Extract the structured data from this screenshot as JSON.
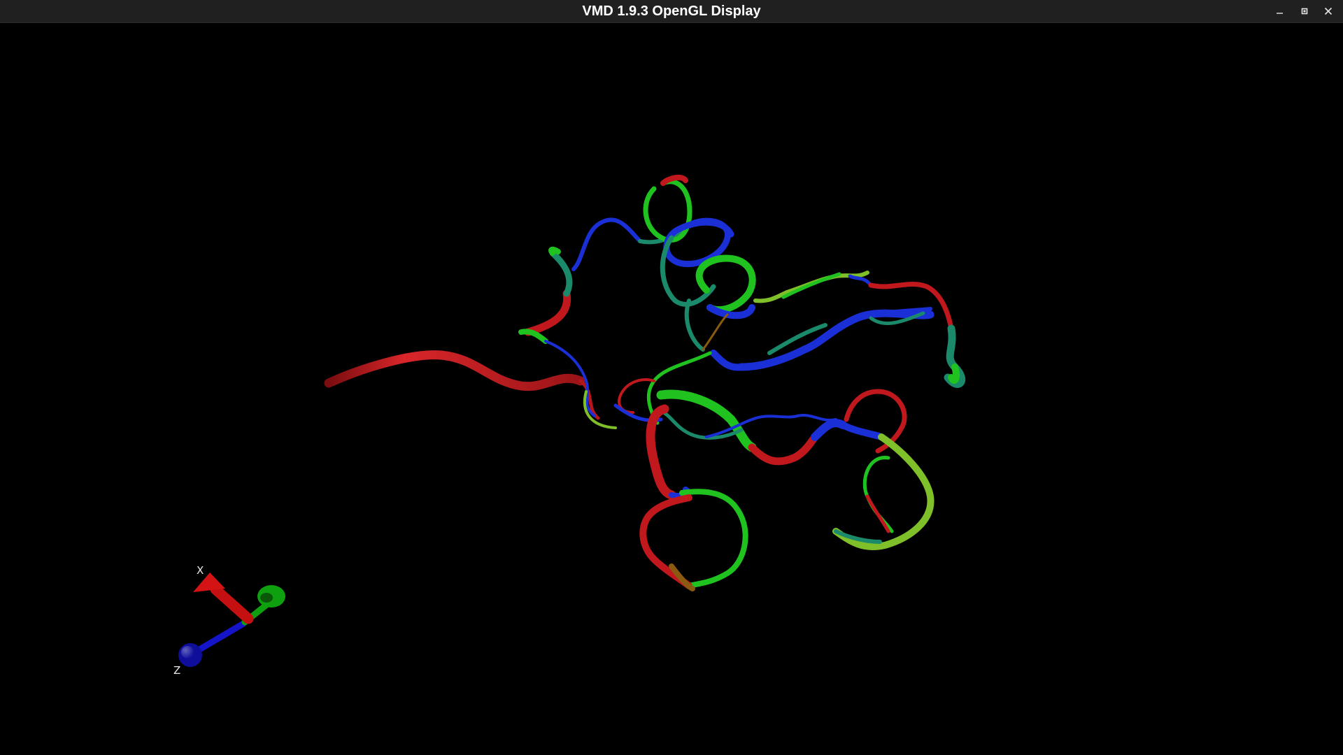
{
  "window": {
    "title": "VMD 1.9.3 OpenGL Display",
    "controls": [
      {
        "name": "minimize",
        "icon": "minimize-icon"
      },
      {
        "name": "maximize",
        "icon": "maximize-icon"
      },
      {
        "name": "close",
        "icon": "close-icon"
      }
    ]
  },
  "display": {
    "background_color": "#000000",
    "representation": "NewCartoon ribbon",
    "ribbon_colors": [
      "#c0181c",
      "#1a2fd6",
      "#1fc21f",
      "#1a8a6a",
      "#7fbf2a"
    ]
  },
  "axes_indicator": {
    "labels": {
      "x": "X",
      "z": "Z"
    },
    "colors": {
      "x": "#c41010",
      "y": "#0fa00f",
      "z": "#1414c8"
    }
  }
}
